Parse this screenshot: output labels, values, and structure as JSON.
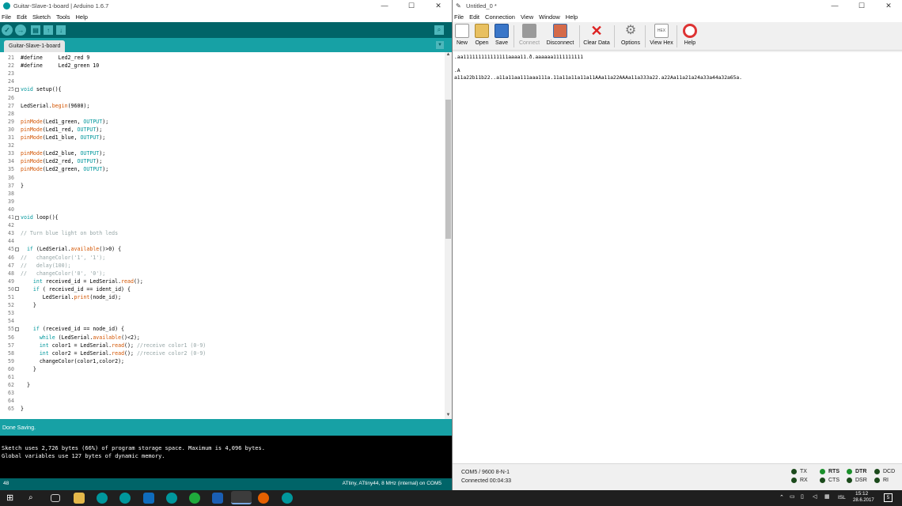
{
  "arduino": {
    "title": "Guitar-Slave-1-board | Arduino 1.6.7",
    "menu": [
      "File",
      "Edit",
      "Sketch",
      "Tools",
      "Help"
    ],
    "tab": "Guitar-Slave-1-board",
    "lines": [
      {
        "n": "21",
        "code": "#define     Led2_red 9"
      },
      {
        "n": "22",
        "code": "#define     Led2_green 10"
      },
      {
        "n": "23",
        "code": ""
      },
      {
        "n": "24",
        "code": ""
      },
      {
        "n": "25",
        "code": "void setup(){",
        "fold": true
      },
      {
        "n": "26",
        "code": ""
      },
      {
        "n": "27",
        "code": "LedSerial.begin(9600);"
      },
      {
        "n": "28",
        "code": ""
      },
      {
        "n": "29",
        "code": "pinMode(Led1_green, OUTPUT);"
      },
      {
        "n": "30",
        "code": "pinMode(Led1_red, OUTPUT);"
      },
      {
        "n": "31",
        "code": "pinMode(Led1_blue, OUTPUT);"
      },
      {
        "n": "32",
        "code": ""
      },
      {
        "n": "33",
        "code": "pinMode(Led2_blue, OUTPUT);"
      },
      {
        "n": "34",
        "code": "pinMode(Led2_red, OUTPUT);"
      },
      {
        "n": "35",
        "code": "pinMode(Led2_green, OUTPUT);"
      },
      {
        "n": "36",
        "code": ""
      },
      {
        "n": "37",
        "code": "}"
      },
      {
        "n": "38",
        "code": ""
      },
      {
        "n": "39",
        "code": ""
      },
      {
        "n": "40",
        "code": ""
      },
      {
        "n": "41",
        "code": "void loop(){",
        "fold": true
      },
      {
        "n": "42",
        "code": ""
      },
      {
        "n": "43",
        "code": "// Turn blue light on both leds"
      },
      {
        "n": "44",
        "code": ""
      },
      {
        "n": "45",
        "code": "  if (LedSerial.available()>0) {",
        "fold": true
      },
      {
        "n": "46",
        "code": "//   changeColor('1', '1');"
      },
      {
        "n": "47",
        "code": "//   delay(100);"
      },
      {
        "n": "48",
        "code": "//   changeColor('0', '0');"
      },
      {
        "n": "49",
        "code": "    int received_id = LedSerial.read();"
      },
      {
        "n": "50",
        "code": "    if ( received_id == ident_id) {",
        "fold": true
      },
      {
        "n": "51",
        "code": "       LedSerial.print(node_id);"
      },
      {
        "n": "52",
        "code": "    }"
      },
      {
        "n": "53",
        "code": ""
      },
      {
        "n": "54",
        "code": ""
      },
      {
        "n": "55",
        "code": "    if (received_id == node_id) {",
        "fold": true
      },
      {
        "n": "56",
        "code": "      while (LedSerial.available()<2);"
      },
      {
        "n": "57",
        "code": "      int color1 = LedSerial.read(); //receive color1 (0-9)"
      },
      {
        "n": "58",
        "code": "      int color2 = LedSerial.read(); //receive color2 (0-9)"
      },
      {
        "n": "59",
        "code": "      changeColor(color1,color2);"
      },
      {
        "n": "60",
        "code": "    }"
      },
      {
        "n": "61",
        "code": ""
      },
      {
        "n": "62",
        "code": "  }"
      },
      {
        "n": "63",
        "code": ""
      },
      {
        "n": "64",
        "code": ""
      },
      {
        "n": "65",
        "code": "}"
      }
    ],
    "status": "Done Saving.",
    "console": [
      "Sketch uses 2,726 bytes (66%) of program storage space. Maximum is 4,096 bytes.",
      "Global variables use 127 bytes of dynamic memory."
    ],
    "line_number": "48",
    "board": "ATtiny, ATtiny44, 8 MHz (internal) on COM5"
  },
  "coolterm": {
    "title": "Untitled_0 *",
    "menu": [
      "File",
      "Edit",
      "Connection",
      "View",
      "Window",
      "Help"
    ],
    "toolbar": {
      "new": "New",
      "open": "Open",
      "save": "Save",
      "connect": "Connect",
      "disconnect": "Disconnect",
      "clear": "Clear Data",
      "options": "Options",
      "viewhex": "View Hex",
      "help": "Help",
      "hex_glyph": "HEX"
    },
    "output": [
      ".aa111111111111111aaaa11.ð.aaaaaa1111111111",
      "",
      ".A",
      "a11a22b11b22..a11a11aa111aaa111a.11a11a11a11a11AAa11a22AAAa11a333a22.a22Aa11a21a24a33a44a32a65a."
    ],
    "port": "COM5 / 9600 8-N-1",
    "connected": "Connected 00:04:33",
    "leds": {
      "tx": "TX",
      "rx": "RX",
      "rts": "RTS",
      "cts": "CTS",
      "dtr": "DTR",
      "dsr": "DSR",
      "dcd": "DCD",
      "ri": "RI"
    }
  },
  "taskbar": {
    "lang": "ISL",
    "time": "15:12",
    "date": "28.6.2017",
    "notif": "5"
  },
  "colors": {
    "arduino_dark": "#006468",
    "arduino_teal": "#17a1a5",
    "led_green": "#1a8f2a",
    "led_dark": "#1c4a1c"
  }
}
